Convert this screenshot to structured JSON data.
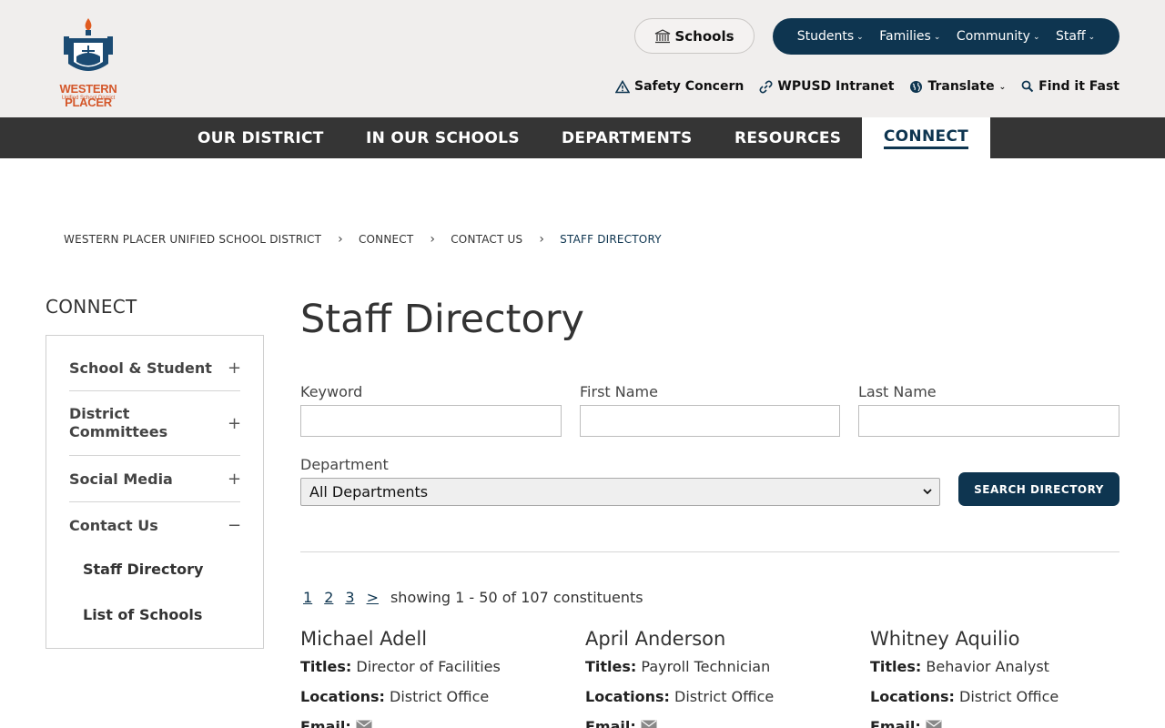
{
  "header": {
    "logo": {
      "name": "WESTERN PLACER",
      "subtitle": "Unified School District"
    },
    "schools_button": "Schools",
    "audience_nav": [
      "Students",
      "Families",
      "Community",
      "Staff"
    ],
    "utility_links": [
      {
        "label": "Safety Concern",
        "icon": "warning-triangle-icon"
      },
      {
        "label": "WPUSD Intranet",
        "icon": "link-icon"
      },
      {
        "label": "Translate",
        "icon": "globe-icon"
      },
      {
        "label": "Find it Fast",
        "icon": "search-icon"
      }
    ]
  },
  "main_nav": [
    "OUR DISTRICT",
    "IN OUR SCHOOLS",
    "DEPARTMENTS",
    "RESOURCES",
    "CONNECT"
  ],
  "breadcrumb": [
    "WESTERN PLACER UNIFIED SCHOOL DISTRICT",
    "CONNECT",
    "CONTACT US",
    "STAFF DIRECTORY"
  ],
  "sidebar": {
    "heading": "CONNECT",
    "items": [
      {
        "label": "School & Student",
        "toggle": "+"
      },
      {
        "label": "District Committees",
        "toggle": "+"
      },
      {
        "label": "Social Media",
        "toggle": "+"
      },
      {
        "label": "Contact Us",
        "toggle": "−"
      }
    ],
    "subitems": [
      "Staff Directory",
      "List of Schools"
    ]
  },
  "main": {
    "title": "Staff Directory",
    "form": {
      "keyword_label": "Keyword",
      "keyword_value": "",
      "first_name_label": "First Name",
      "first_name_value": "",
      "last_name_label": "Last Name",
      "last_name_value": "",
      "department_label": "Department",
      "department_selected": "All Departments",
      "search_button": "SEARCH DIRECTORY"
    },
    "pager": {
      "pages": [
        "1",
        "2",
        "3"
      ],
      "next": ">",
      "summary": "showing 1 - 50 of 107 constituents"
    },
    "labels": {
      "titles": "Titles:",
      "locations": "Locations:",
      "email": "Email:"
    },
    "staff": [
      {
        "name": "Michael Adell",
        "title": "Director of Facilities",
        "location": "District Office"
      },
      {
        "name": "April Anderson",
        "title": "Payroll Technician",
        "location": "District Office"
      },
      {
        "name": "Whitney Aquilio",
        "title": "Behavior Analyst",
        "location": "District Office"
      }
    ]
  },
  "colors": {
    "brand_navy": "#0e3550",
    "nav_dark": "#353535",
    "logo_orange": "#d4572a",
    "header_bg": "#f0eeed"
  }
}
